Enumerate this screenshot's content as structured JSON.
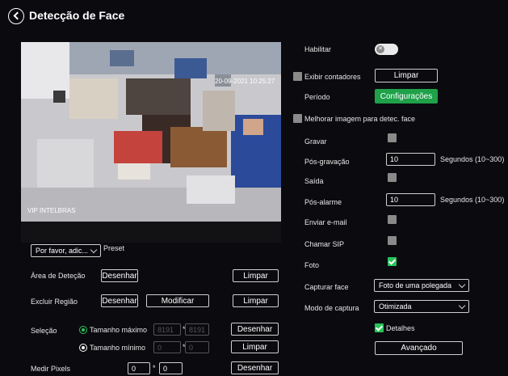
{
  "header": {
    "title": "Detecção de Face"
  },
  "video": {
    "timestamp": "20-09-2021 10:25:27",
    "channel_name": "VIP INTELBRAS"
  },
  "preset": {
    "dropdown_value": "Por favor, adic...",
    "label": "Preset"
  },
  "left": {
    "area_deteccao": {
      "label": "Área de Deteção",
      "draw": "Desenhar",
      "clear": "Limpar"
    },
    "excluir_regiao": {
      "label": "Excluir Região",
      "draw": "Desenhar",
      "modify": "Modificar",
      "clear": "Limpar"
    },
    "selecao": {
      "label": "Seleção",
      "max": {
        "label": "Tamanho máximo",
        "w": "8191",
        "h": "8191",
        "button": "Desenhar"
      },
      "min": {
        "label": "Tamanho mínimo",
        "w": "0",
        "h": "0",
        "button": "Limpar"
      }
    },
    "medir_pixels": {
      "label": "Medir Pixels",
      "w": "0",
      "h": "0",
      "button": "Desenhar"
    },
    "separator": "*"
  },
  "right": {
    "habilitar": {
      "label": "Habilitar",
      "enabled": false
    },
    "exibir_contadores": {
      "label": "Exibir contadores",
      "button": "Limpar",
      "checked": false
    },
    "periodo": {
      "label": "Período",
      "button": "Configurações"
    },
    "melhorar": {
      "label": "Melhorar imagem para detec. face",
      "checked": false
    },
    "gravar": {
      "label": "Gravar",
      "checked": false
    },
    "pos_gravacao": {
      "label": "Pós-gravação",
      "value": "10",
      "unit": "Segundos (10~300)"
    },
    "saida": {
      "label": "Saída",
      "checked": false
    },
    "pos_alarme": {
      "label": "Pós-alarme",
      "value": "10",
      "unit": "Segundos (10~300)"
    },
    "enviar_email": {
      "label": "Enviar e-mail",
      "checked": false
    },
    "chamar_sip": {
      "label": "Chamar SIP",
      "checked": false
    },
    "foto": {
      "label": "Foto",
      "checked": true
    },
    "capturar_face": {
      "label": "Capturar face",
      "value": "Foto de uma polegada"
    },
    "modo_captura": {
      "label": "Modo de captura",
      "value": "Otimizada"
    },
    "detalhes": {
      "label": "Detalhes",
      "checked": true
    },
    "avancado": {
      "button": "Avançado"
    }
  },
  "colors": {
    "background": "#0b0b0f",
    "accent_green": "#1fa14a",
    "checkbox_off": "#8a8a8a"
  }
}
